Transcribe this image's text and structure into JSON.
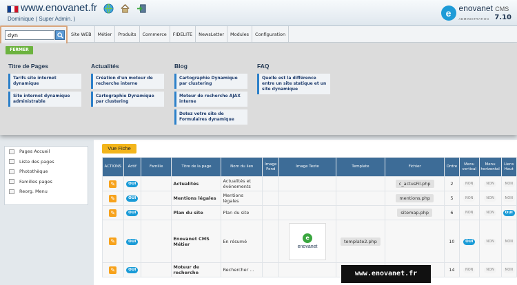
{
  "header": {
    "site_title": "www.enovanet.fr",
    "user": "Dominique ( Super Admin. )",
    "brand_name": "enovanet",
    "brand_cms": "CMS",
    "brand_sub": "ADMINISTRATION",
    "version": "7.10",
    "flag_colors": [
      "#0b3d91",
      "#ffffff",
      "#ce1126"
    ],
    "brand_color": "#1e9bd7"
  },
  "search": {
    "value": "dyn"
  },
  "nav": {
    "items": [
      "Site WEB",
      "Métier",
      "Produits",
      "Commerce",
      "FIDELITE",
      "NewsLetter",
      "Modules",
      "Configuration"
    ]
  },
  "results": {
    "close_label": "FERMER",
    "columns": [
      {
        "title": "Titre de Pages",
        "items": [
          "Tarifs site internet dynamique",
          "Site internet dynamique administrable"
        ]
      },
      {
        "title": "Actualités",
        "items": [
          "Création d'un moteur de recherche interne",
          "Cartographie Dynamique par clustering"
        ]
      },
      {
        "title": "Blog",
        "items": [
          "Cartographie Dynamique par clustering",
          "Moteur de recherche AJAX interne",
          "Dotez votre site de Formulaires dynamique"
        ]
      },
      {
        "title": "FAQ",
        "items": [
          "Quelle est la différence entre un site statique et un site dynamique"
        ]
      }
    ]
  },
  "sidebar": {
    "items": [
      "Pages Accueil",
      "Liste des pages",
      "Photothèque",
      "Familles pages",
      "Reorg. Menu"
    ]
  },
  "main": {
    "vue_fiche_label": "Vue Fiche",
    "headers": [
      "ACTIONS",
      "Actif",
      "Famille",
      "Titre de la page",
      "Nom du lien",
      "Image Fond",
      "Image Texte",
      "Template",
      "Fichier",
      "Ordre",
      "Menu vertical",
      "Menu horizontal",
      "Liens Haut"
    ],
    "oui_label": "OUI",
    "non_label": "NON",
    "thumb_name": "enovanet",
    "rows": [
      {
        "titre": "Actualités",
        "lien": "Actualités et événements",
        "template": "",
        "fichier": "c_actusFil.php",
        "ordre": "2",
        "menu_vertical": "NON",
        "menu_horizontal": "NON",
        "liens_haut": "NON"
      },
      {
        "titre": "Mentions légales",
        "lien": "Mentions légales",
        "template": "",
        "fichier": "mentions.php",
        "ordre": "5",
        "menu_vertical": "NON",
        "menu_horizontal": "NON",
        "liens_haut": "NON"
      },
      {
        "titre": "Plan du site",
        "lien": "Plan du site",
        "template": "",
        "fichier": "sitemap.php",
        "ordre": "6",
        "menu_vertical": "NON",
        "menu_horizontal": "NON",
        "liens_haut": "OUI"
      },
      {
        "titre": "Enovanet CMS Métier",
        "lien": "En résumé",
        "template": "template2.php",
        "fichier": "",
        "ordre": "10",
        "menu_vertical": "OUI",
        "menu_horizontal": "NON",
        "liens_haut": "NON"
      },
      {
        "titre": "Moteur de recherche",
        "lien": "Rechercher ...",
        "template": "",
        "fichier": "",
        "ordre": "14",
        "menu_vertical": "NON",
        "menu_horizontal": "NON",
        "liens_haut": "NON"
      }
    ]
  },
  "watermark": "www.enovanet.fr"
}
